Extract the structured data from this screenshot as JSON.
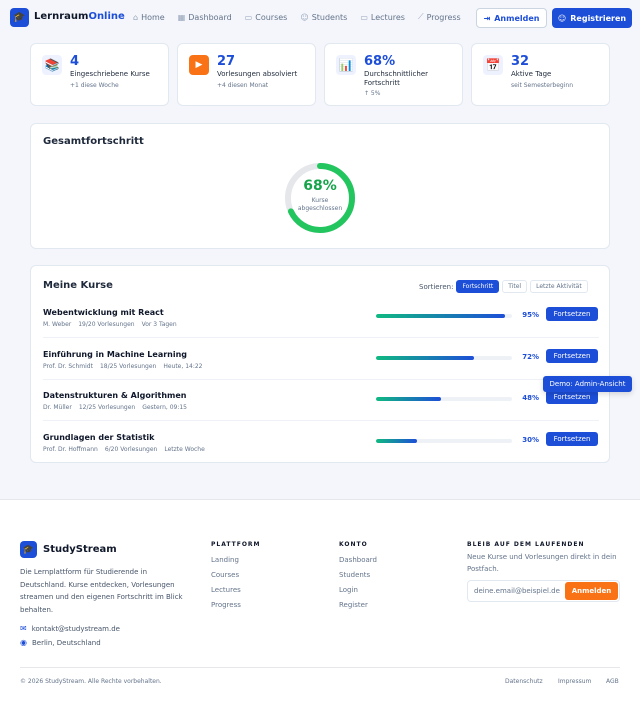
{
  "header": {
    "brand_main": "Lernraum",
    "brand_accent": "Online",
    "nav": [
      {
        "label": "Home",
        "icon": "home-icon"
      },
      {
        "label": "Dashboard",
        "icon": "dashboard-icon"
      },
      {
        "label": "Courses",
        "icon": "book-icon"
      },
      {
        "label": "Students",
        "icon": "users-icon"
      },
      {
        "label": "Lectures",
        "icon": "video-icon"
      },
      {
        "label": "Progress",
        "icon": "chart-icon"
      }
    ],
    "login_label": "Anmelden",
    "register_label": "Registrieren"
  },
  "stats": [
    {
      "value": "4",
      "label": "Eingeschriebene Kurse",
      "sub": "+1 diese Woche",
      "icon": "books-icon",
      "icon_glyph": "📚"
    },
    {
      "value": "27",
      "label": "Vorlesungen absolviert",
      "sub": "+4 diesen Monat",
      "icon": "play-icon",
      "icon_glyph": "▶"
    },
    {
      "value": "68%",
      "label": "Durchschnittlicher Fortschritt",
      "sub": "↑ 5%",
      "icon": "bar-chart-icon",
      "icon_glyph": "📊"
    },
    {
      "value": "32",
      "label": "Aktive Tage",
      "sub": "seit Semesterbeginn",
      "icon": "calendar-icon",
      "icon_glyph": "📅"
    }
  ],
  "overall": {
    "title": "Gesamtfortschritt",
    "percent_label": "68%",
    "fraction": 0.68,
    "caption": "Kurse abgeschlossen"
  },
  "courses": {
    "title": "Meine Kurse",
    "sort_label": "Sortieren:",
    "sort_options": [
      "Fortschritt",
      "Titel",
      "Letzte Aktivität"
    ],
    "sort_active": "Fortschritt",
    "continue_label": "Fortsetzen",
    "items": [
      {
        "title": "Webentwicklung mit React",
        "instructor": "M. Weber",
        "lectures": "19/20 Vorlesungen",
        "last": "Vor 3 Tagen",
        "progress": 0.95,
        "percent_label": "95%"
      },
      {
        "title": "Einführung in Machine Learning",
        "instructor": "Prof. Dr. Schmidt",
        "lectures": "18/25 Vorlesungen",
        "last": "Heute, 14:22",
        "progress": 0.72,
        "percent_label": "72%"
      },
      {
        "title": "Datenstrukturen & Algorithmen",
        "instructor": "Dr. Müller",
        "lectures": "12/25 Vorlesungen",
        "last": "Gestern, 09:15",
        "progress": 0.48,
        "percent_label": "48%"
      },
      {
        "title": "Grundlagen der Statistik",
        "instructor": "Prof. Dr. Hoffmann",
        "lectures": "6/20 Vorlesungen",
        "last": "Letzte Woche",
        "progress": 0.3,
        "percent_label": "30%"
      }
    ],
    "tooltip": "Demo: Admin-Ansicht"
  },
  "footer": {
    "brand": "StudyStream",
    "description": "Die Lernplattform für Studierende in Deutschland. Kurse entdecken, Vorlesungen streamen und den eigenen Fortschritt im Blick behalten.",
    "email": "kontakt@studystream.de",
    "location": "Berlin, Deutschland",
    "platform_title": "PLATTFORM",
    "platform_links": [
      "Landing",
      "Courses",
      "Lectures",
      "Progress"
    ],
    "account_title": "KONTO",
    "account_links": [
      "Dashboard",
      "Students",
      "Login",
      "Register"
    ],
    "newsletter_title": "BLEIB AUF DEM LAUFENDEN",
    "newsletter_text": "Neue Kurse und Vorlesungen direkt in dein Postfach.",
    "newsletter_placeholder": "deine.email@beispiel.de",
    "newsletter_button": "Anmelden",
    "copyright": "© 2026 StudyStream. Alle Rechte vorbehalten.",
    "legal": [
      "Datenschutz",
      "Impressum",
      "AGB"
    ]
  },
  "colors": {
    "primary": "#1d4ed8",
    "success": "#16a34a",
    "accent_orange": "#f97316",
    "bg": "#f4f6fb"
  }
}
